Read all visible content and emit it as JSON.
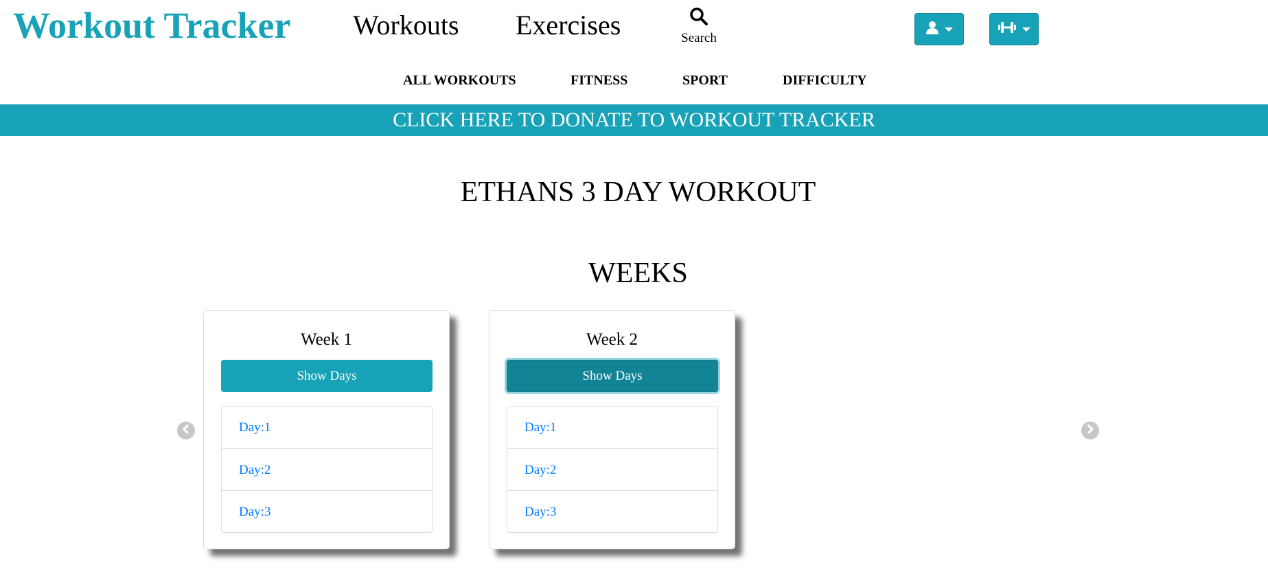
{
  "header": {
    "brand": "Workout Tracker",
    "nav": [
      {
        "label": "Workouts"
      },
      {
        "label": "Exercises"
      }
    ],
    "search": {
      "label": "Search",
      "icon": "search-icon"
    },
    "user_dropdown": {
      "icon": "user-icon"
    },
    "workout_dropdown": {
      "icon": "dumbbell-icon"
    }
  },
  "subnav": [
    {
      "label": "ALL WORKOUTS"
    },
    {
      "label": "FITNESS"
    },
    {
      "label": "SPORT"
    },
    {
      "label": "DIFFICULTY"
    }
  ],
  "donate_banner": "CLICK HERE TO DONATE TO WORKOUT TRACKER",
  "workout": {
    "title": "ETHANS 3 DAY WORKOUT",
    "section_title": "WEEKS",
    "weeks": [
      {
        "title": "Week 1",
        "button": "Show Days",
        "days": [
          "Day:1",
          "Day:2",
          "Day:3"
        ]
      },
      {
        "title": "Week 2",
        "button": "Show Days",
        "days": [
          "Day:1",
          "Day:2",
          "Day:3"
        ]
      }
    ]
  },
  "colors": {
    "accent": "#17a2b8",
    "accent_dark": "#138496",
    "link": "#007bff",
    "arrow": "#c7c7c7"
  }
}
